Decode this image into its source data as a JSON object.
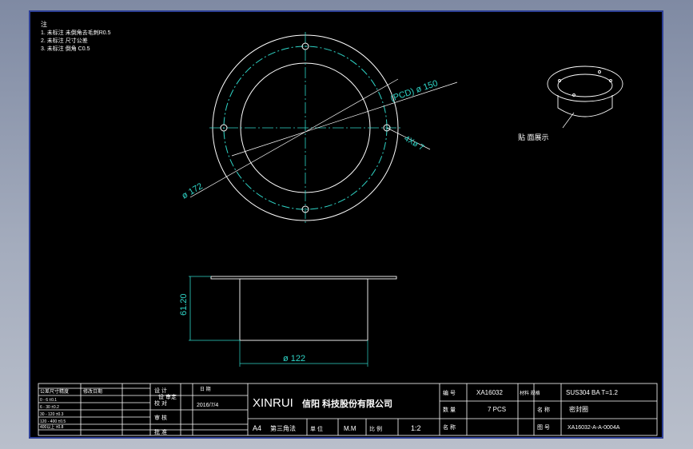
{
  "notes": {
    "title": "注",
    "lines": [
      "1. 未标注 未倒角去毛刺R0.5",
      "2. 未标注 尺寸公差",
      "3. 未标注 倒角 C0.5"
    ]
  },
  "top_view": {
    "pcd_label": "(PCD) ø 150",
    "hole_label": "4Xø 7",
    "outer_label": "ø 172"
  },
  "side_view": {
    "height_label": "61.20",
    "diameter_label": "ø 122"
  },
  "iso_view": {
    "caption": "贴 面展示"
  },
  "title_block": {
    "company_en": "XINRUI",
    "company_cn": "信阳 科技股份有限公司",
    "date": "2016/7/4",
    "drawn_by": "设 审定",
    "part_code": "XA16032",
    "quantity": "7  PCS",
    "material": "SUS304 BA  T=1.2",
    "part_name": "密封圈",
    "drawing_no": "XA16032-A-A-0004A",
    "paper_size": "A4",
    "angle": "第三角法",
    "unit": "M.M",
    "scale": "1:2",
    "labels": {
      "tolerance_header": "公差尺寸精度",
      "rev_header": "修改日期",
      "design": "设 计",
      "check": "校 对",
      "review": "审 核",
      "approve": "批 准",
      "date_header": "日 期",
      "unit_label": "单 位",
      "scale_label": "比 例",
      "code_label": "编 号",
      "material_label": "材料 规格",
      "qty_label": "数 量",
      "name_label": "名 称",
      "dwg_label": "图 号"
    },
    "tolerance_rows": [
      "0 - 6   ±0.1",
      "6 - 30  ±0.2",
      "30 - 120 ±0.3",
      "120 - 400 ±0.5",
      "400以上 ±0.8"
    ]
  }
}
